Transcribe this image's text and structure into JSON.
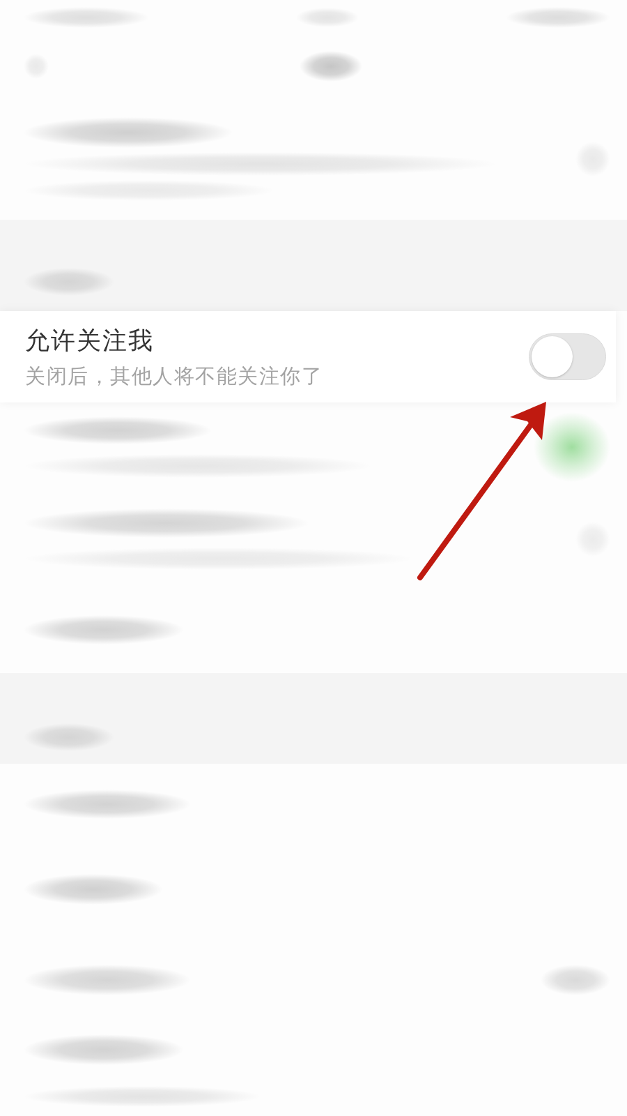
{
  "setting": {
    "title": "允许关注我",
    "description": "关闭后，其他人将不能关注你了",
    "on": false
  }
}
